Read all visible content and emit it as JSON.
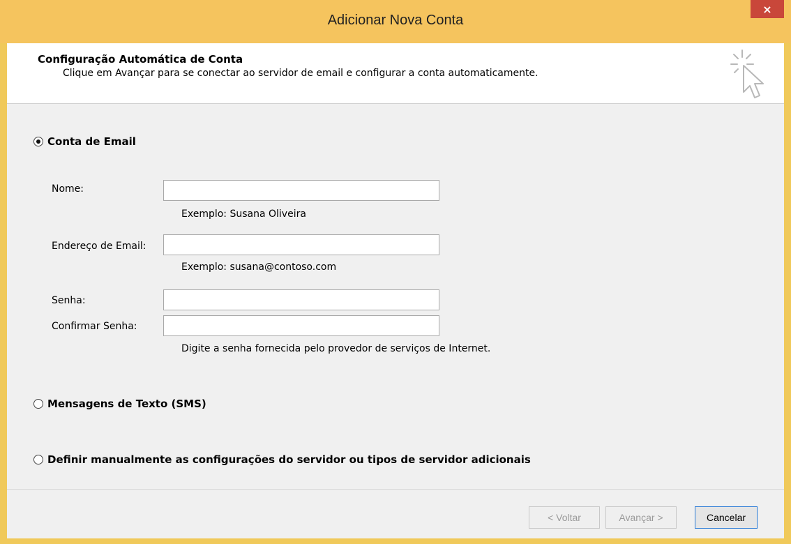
{
  "window": {
    "title": "Adicionar Nova Conta",
    "close_label": "×"
  },
  "header": {
    "title": "Configuração Automática de Conta",
    "subtitle": "Clique em Avançar para se conectar ao servidor de email e configurar a conta automaticamente.",
    "icon": "cursor-click-icon"
  },
  "options": {
    "email": {
      "label": "Conta de Email",
      "selected": true
    },
    "sms": {
      "label": "Mensagens de Texto (SMS)",
      "selected": false
    },
    "manual": {
      "label": "Definir manualmente as configurações do servidor ou tipos de servidor adicionais",
      "selected": false
    }
  },
  "form": {
    "name": {
      "label": "Nome:",
      "value": "",
      "hint": "Exemplo: Susana Oliveira"
    },
    "email": {
      "label": "Endereço de Email:",
      "value": "",
      "hint": "Exemplo: susana@contoso.com"
    },
    "password": {
      "label": "Senha:",
      "value": ""
    },
    "confirm_password": {
      "label": "Confirmar Senha:",
      "value": "",
      "hint": "Digite a senha fornecida pelo provedor de serviços de Internet."
    }
  },
  "buttons": {
    "back": "< Voltar",
    "next": "Avançar >",
    "cancel": "Cancelar"
  },
  "colors": {
    "titlebar": "#f5c45e",
    "close": "#c9473a",
    "default_button_border": "#2a7bd6"
  }
}
